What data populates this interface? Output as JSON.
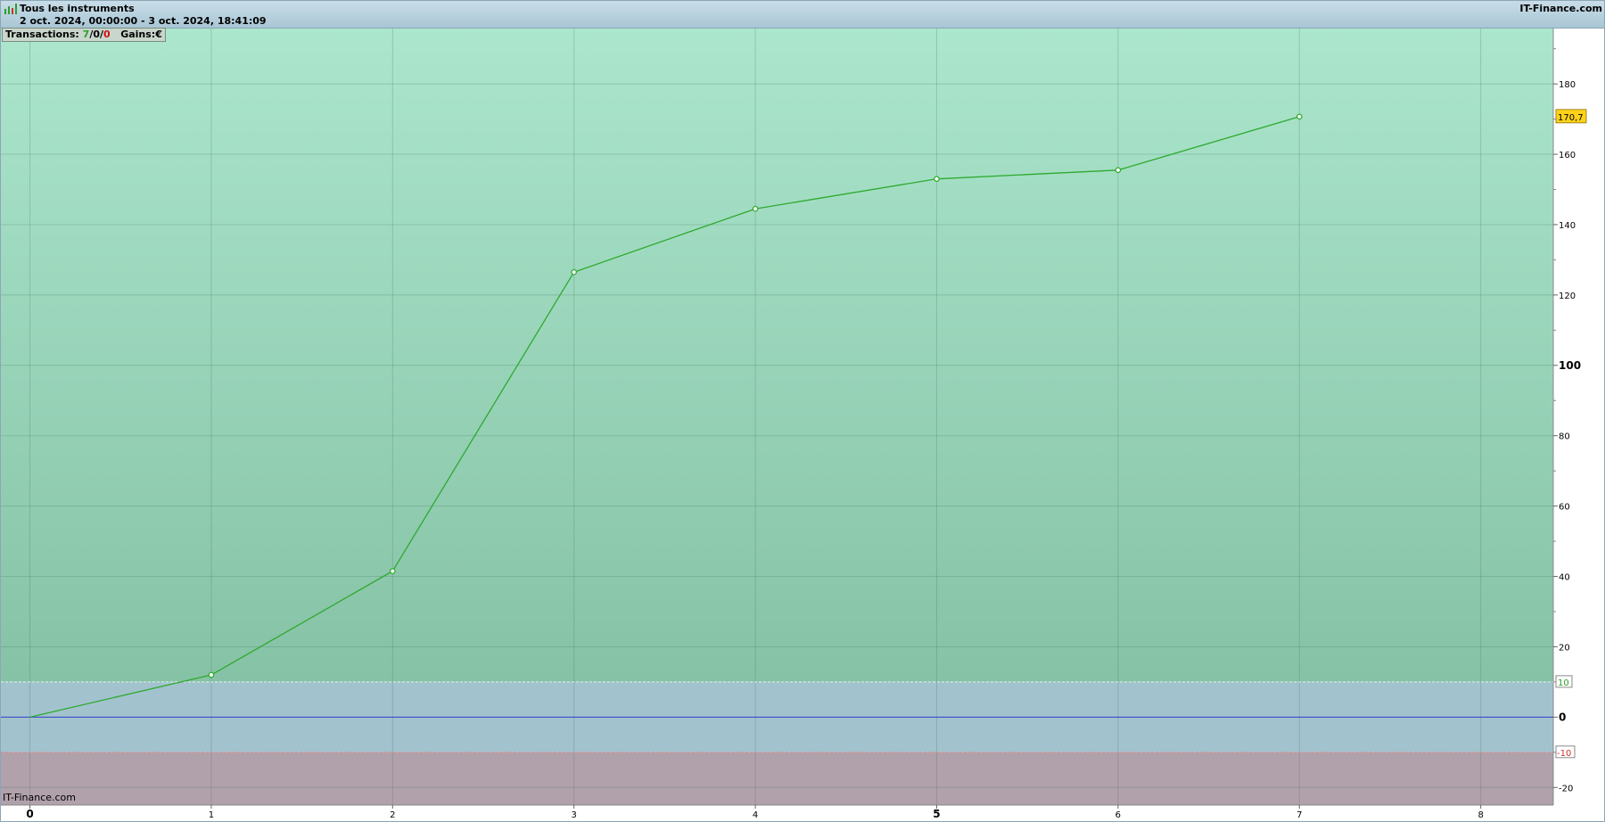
{
  "header": {
    "title": "Tous les instruments",
    "period": "2 oct. 2024, 00:00:00 - 3 oct. 2024, 18:41:09",
    "brand": "IT-Finance.com"
  },
  "stats": {
    "transactions_label": "Transactions:",
    "count_total": "7",
    "count_mid": "0",
    "count_loss": "0",
    "sep": "/",
    "gains_label": "Gains:",
    "gains_currency": "€"
  },
  "watermark": "IT-Finance.com",
  "colors": {
    "line": "#2eaa2e",
    "zero_line": "#3344cc",
    "upper_bg_top": "#abe6cd",
    "upper_bg_bottom": "#86c2a5",
    "neutral_band": "#a2c2ce",
    "lower_band": "#b1a1ab",
    "last_value_badge": "#ffd21a",
    "upper_threshold_text": "#2aa02a",
    "lower_threshold_text": "#d03030"
  },
  "chart_data": {
    "type": "line",
    "x": [
      0,
      1,
      2,
      3,
      4,
      5,
      6,
      7
    ],
    "series": [
      {
        "values": [
          0,
          12,
          41.5,
          126.5,
          144.5,
          153,
          155.5,
          170.7
        ]
      }
    ],
    "xlim": [
      -0.16,
      8.4
    ],
    "ylim": [
      -25,
      196
    ],
    "x_ticks": [
      "0",
      "1",
      "2",
      "3",
      "4",
      "5",
      "6",
      "7",
      "8"
    ],
    "y_ticks": [
      -20,
      0,
      20,
      40,
      60,
      80,
      100,
      120,
      140,
      160,
      180
    ],
    "y_tick_labels": [
      "-20",
      "0",
      "20",
      "40",
      "60",
      "80",
      "100",
      "120",
      "140",
      "160",
      "180"
    ],
    "bold_x_ticks": [
      "0",
      "5"
    ],
    "bold_y_ticks": [
      "0",
      "100"
    ],
    "thresholds": {
      "upper": 10,
      "lower": -10,
      "upper_label": "10",
      "lower_label": "-10"
    },
    "last_value_label": "170,7",
    "grid": true
  }
}
